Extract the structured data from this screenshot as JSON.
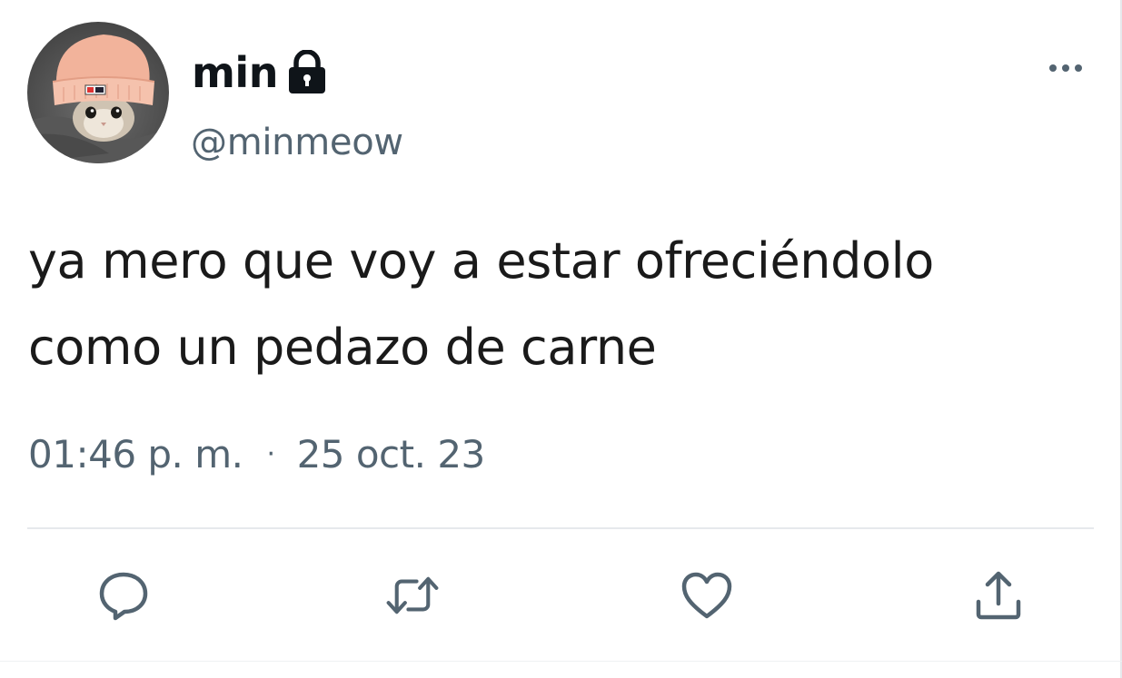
{
  "author": {
    "display_name": "min",
    "handle": "@minmeow",
    "protected_icon": "lock-icon",
    "avatar_icon": "cat-in-beanie-avatar"
  },
  "tweet": {
    "text_line_1": "ya mero que voy a estar ofreciéndolo",
    "text_line_2": "como un pedazo de carne",
    "time": "01:46 p. m.",
    "separator": "·",
    "date": "25 oct. 23"
  },
  "actions": {
    "reply_icon": "reply-icon",
    "retweet_icon": "retweet-icon",
    "like_icon": "heart-icon",
    "share_icon": "share-icon",
    "more_icon": "more-icon"
  },
  "colors": {
    "text_primary": "#0f1419",
    "text_secondary": "#536471",
    "divider": "#e6e9ec"
  }
}
